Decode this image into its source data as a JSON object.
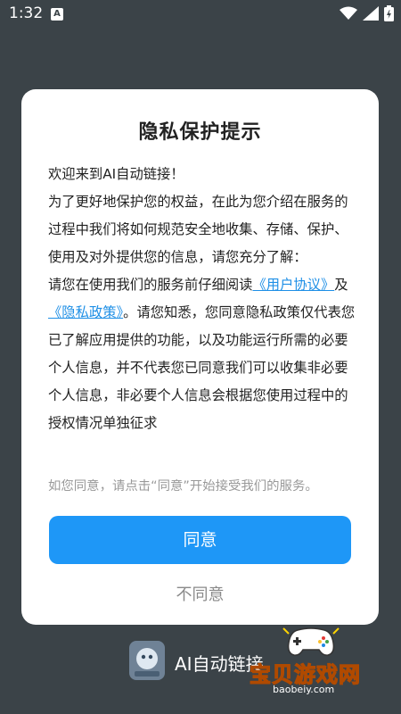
{
  "status_bar": {
    "time": "1:32",
    "notification_badge": "A",
    "icons": [
      "wifi-icon",
      "signal-icon",
      "battery-icon"
    ]
  },
  "dialog": {
    "title": "隐私保护提示",
    "welcome": "欢迎来到AI自动链接！",
    "intro": "为了更好地保护您的权益，在此为您介绍在服务的过程中我们将如何规范安全地收集、存储、保护、使用及对外提供您的信息，请您充分了解：",
    "read_prefix": "请您在使用我们的服务前仔细阅读",
    "user_agreement_link": "《用户协议》",
    "and": "及",
    "privacy_policy_link": "《隐私政策》",
    "notice_text": "。请您知悉，您同意隐私政策仅代表您已了解应用提供的功能，以及功能运行所需的必要个人信息，并不代表您已同意我们可以收集非必要个人信息，非必要个人信息会根据您使用过程中的授权情况单独征求",
    "hint": "如您同意，请点击“同意”开始接受我们的服务。",
    "agree_label": "同意",
    "disagree_label": "不同意"
  },
  "background_app": {
    "name": "AI自动链接"
  },
  "watermark": {
    "text": "宝贝游戏网",
    "url": "baobeiy.com"
  },
  "colors": {
    "overlay": "#3b4348",
    "accent": "#1e97f7",
    "link": "#1e8fe6"
  }
}
